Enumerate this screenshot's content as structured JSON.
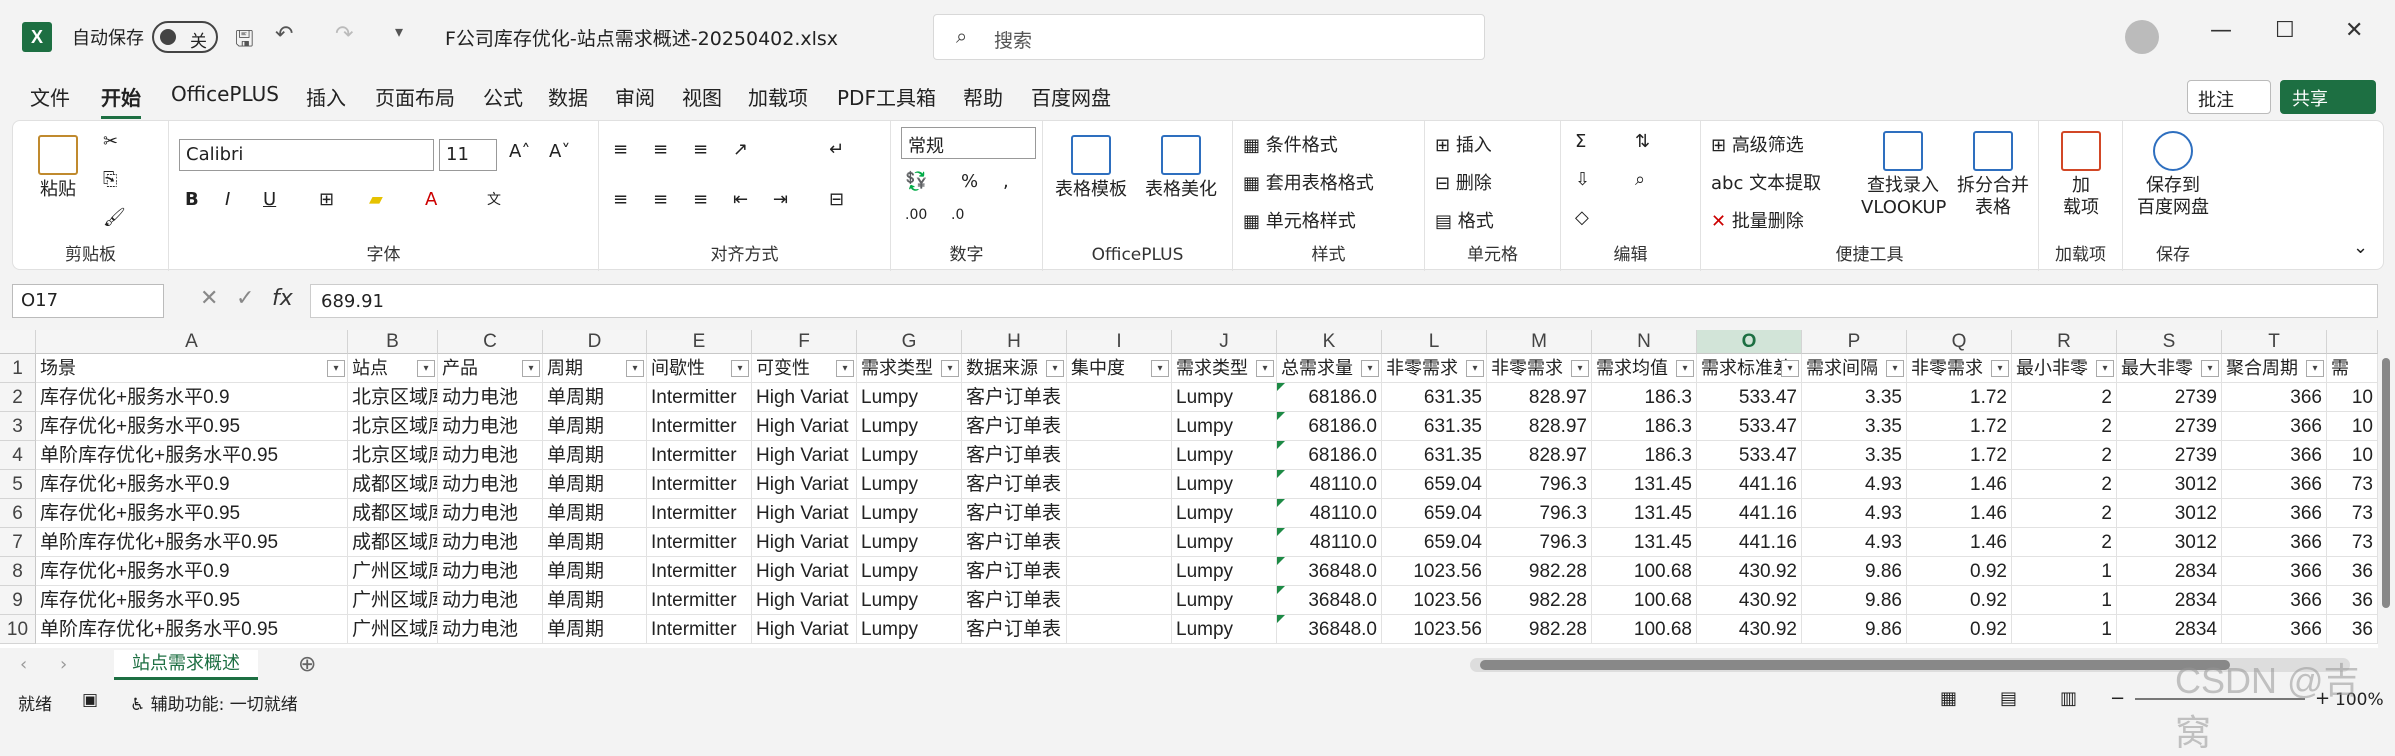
{
  "app": {
    "logo": "X",
    "autosave_label": "自动保存",
    "autosave_state": "关",
    "title": "F公司库存优化-站点需求概述-20250402.xlsx",
    "search_placeholder": "搜索"
  },
  "menu": [
    "文件",
    "开始",
    "OfficePLUS",
    "插入",
    "页面布局",
    "公式",
    "数据",
    "审阅",
    "视图",
    "加载项",
    "PDF工具箱",
    "帮助",
    "百度网盘"
  ],
  "menu_active": "开始",
  "menu_right": {
    "comment": "批注",
    "share": "共享"
  },
  "ribbon": {
    "clipboard": {
      "paste": "粘贴",
      "label": "剪贴板"
    },
    "font": {
      "name": "Calibri",
      "size": "11",
      "label": "字体"
    },
    "alignment": {
      "label": "对齐方式"
    },
    "number": {
      "format": "常规",
      "label": "数字"
    },
    "officeplus": {
      "table_template": "表格模板",
      "table_beautify": "表格美化",
      "label": "OfficePLUS"
    },
    "styles": {
      "conditional": "条件格式",
      "table_format": "套用表格格式",
      "cell_style": "单元格样式",
      "label": "样式"
    },
    "cells": {
      "insert": "插入",
      "delete": "删除",
      "format": "格式",
      "label": "单元格"
    },
    "editing": {
      "label": "编辑"
    },
    "tools": {
      "advanced_filter": "高级筛选",
      "text_extract": "文本提取",
      "batch_delete": "批量删除",
      "vlookup_1": "查找录入",
      "vlookup_2": "VLOOKUP",
      "split_1": "拆分合并",
      "split_2": "表格",
      "label": "便捷工具"
    },
    "addins": {
      "addin_1": "加",
      "addin_2": "载项",
      "label": "加载项"
    },
    "save": {
      "save_1": "保存到",
      "save_2": "百度网盘",
      "label": "保存"
    }
  },
  "formula_bar": {
    "cell_ref": "O17",
    "fx": "fx",
    "value": "689.91"
  },
  "sheet": {
    "columns": [
      "A",
      "B",
      "C",
      "D",
      "E",
      "F",
      "G",
      "H",
      "I",
      "J",
      "K",
      "L",
      "M",
      "N",
      "O",
      "P",
      "Q",
      "R",
      "S",
      "T"
    ],
    "headers": [
      "场景",
      "站点",
      "产品",
      "周期",
      "间歇性",
      "可变性",
      "需求类型",
      "数据来源",
      "集中度",
      "需求类型",
      "总需求量",
      "非零需求",
      "非零需求",
      "需求均值",
      "需求标准差",
      "需求间隔",
      "非零需求",
      "最小非零",
      "最大非零",
      "聚合周期"
    ],
    "rows": [
      [
        "库存优化+服务水平0.9",
        "北京区域库",
        "动力电池",
        "单周期",
        "Intermitter",
        "High Variat",
        "Lumpy",
        "客户订单表",
        "",
        "Lumpy",
        "68186.0",
        "631.35",
        "828.97",
        "186.3",
        "533.47",
        "3.35",
        "1.72",
        "2",
        "2739",
        "366"
      ],
      [
        "库存优化+服务水平0.95",
        "北京区域库",
        "动力电池",
        "单周期",
        "Intermitter",
        "High Variat",
        "Lumpy",
        "客户订单表",
        "",
        "Lumpy",
        "68186.0",
        "631.35",
        "828.97",
        "186.3",
        "533.47",
        "3.35",
        "1.72",
        "2",
        "2739",
        "366"
      ],
      [
        "单阶库存优化+服务水平0.95",
        "北京区域库",
        "动力电池",
        "单周期",
        "Intermitter",
        "High Variat",
        "Lumpy",
        "客户订单表",
        "",
        "Lumpy",
        "68186.0",
        "631.35",
        "828.97",
        "186.3",
        "533.47",
        "3.35",
        "1.72",
        "2",
        "2739",
        "366"
      ],
      [
        "库存优化+服务水平0.9",
        "成都区域库",
        "动力电池",
        "单周期",
        "Intermitter",
        "High Variat",
        "Lumpy",
        "客户订单表",
        "",
        "Lumpy",
        "48110.0",
        "659.04",
        "796.3",
        "131.45",
        "441.16",
        "4.93",
        "1.46",
        "2",
        "3012",
        "366"
      ],
      [
        "库存优化+服务水平0.95",
        "成都区域库",
        "动力电池",
        "单周期",
        "Intermitter",
        "High Variat",
        "Lumpy",
        "客户订单表",
        "",
        "Lumpy",
        "48110.0",
        "659.04",
        "796.3",
        "131.45",
        "441.16",
        "4.93",
        "1.46",
        "2",
        "3012",
        "366"
      ],
      [
        "单阶库存优化+服务水平0.95",
        "成都区域库",
        "动力电池",
        "单周期",
        "Intermitter",
        "High Variat",
        "Lumpy",
        "客户订单表",
        "",
        "Lumpy",
        "48110.0",
        "659.04",
        "796.3",
        "131.45",
        "441.16",
        "4.93",
        "1.46",
        "2",
        "3012",
        "366"
      ],
      [
        "库存优化+服务水平0.9",
        "广州区域库",
        "动力电池",
        "单周期",
        "Intermitter",
        "High Variat",
        "Lumpy",
        "客户订单表",
        "",
        "Lumpy",
        "36848.0",
        "1023.56",
        "982.28",
        "100.68",
        "430.92",
        "9.86",
        "0.92",
        "1",
        "2834",
        "366"
      ],
      [
        "库存优化+服务水平0.95",
        "广州区域库",
        "动力电池",
        "单周期",
        "Intermitter",
        "High Variat",
        "Lumpy",
        "客户订单表",
        "",
        "Lumpy",
        "36848.0",
        "1023.56",
        "982.28",
        "100.68",
        "430.92",
        "9.86",
        "0.92",
        "1",
        "2834",
        "366"
      ],
      [
        "单阶库存优化+服务水平0.95",
        "广州区域库",
        "动力电池",
        "单周期",
        "Intermitter",
        "High Variat",
        "Lumpy",
        "客户订单表",
        "",
        "Lumpy",
        "36848.0",
        "1023.56",
        "982.28",
        "100.68",
        "430.92",
        "9.86",
        "0.92",
        "1",
        "2834",
        "366"
      ]
    ],
    "partial_col_header": "需",
    "partial_col_values": [
      "10",
      "10",
      "10",
      "73",
      "73",
      "73",
      "36",
      "36",
      "36"
    ],
    "tab": "站点需求概述"
  },
  "status": {
    "ready": "就绪",
    "accessibility": "辅助功能: 一切就绪",
    "zoom": "100%"
  },
  "watermark": "CSDN @吉窝"
}
